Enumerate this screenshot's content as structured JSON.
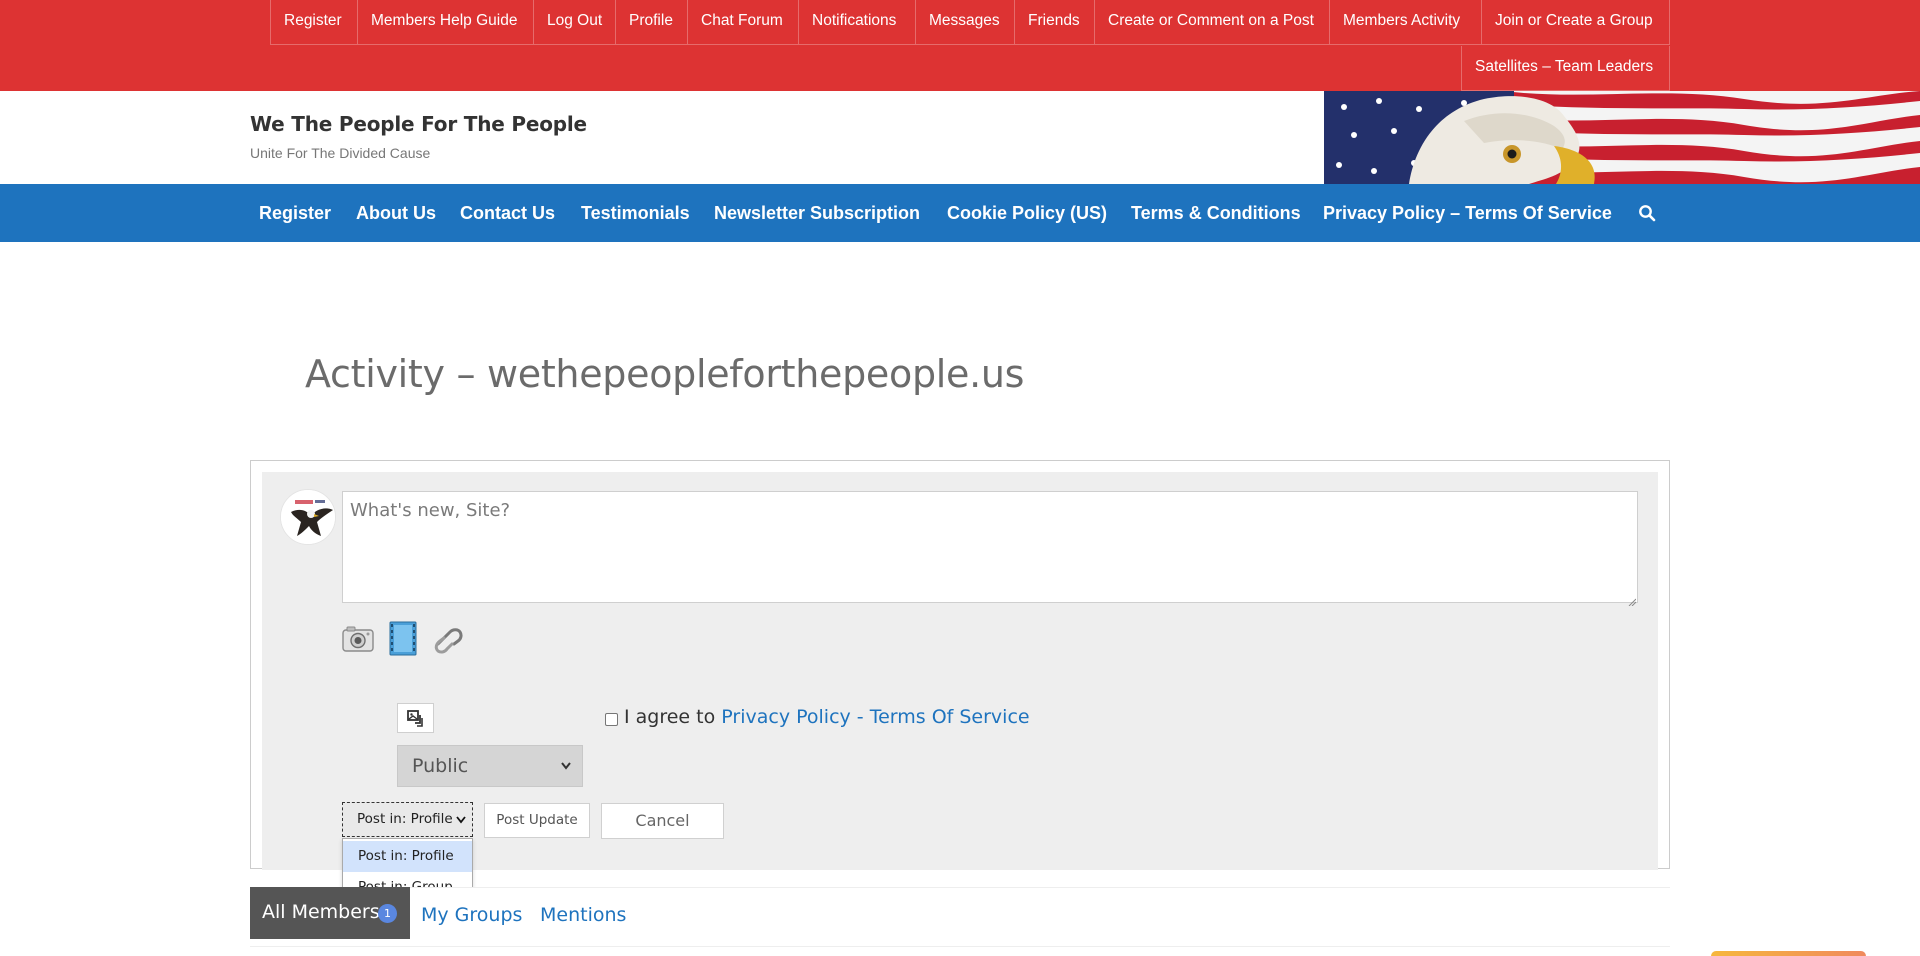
{
  "top_menu": {
    "items": [
      "Register",
      "Members Help Guide",
      "Log Out",
      "Profile",
      "Chat Forum",
      "Notifications",
      "Messages",
      "Friends",
      "Create or Comment on a Post",
      "Members Activity",
      "Join or Create a Group"
    ],
    "second_row": [
      "Satellites – Team Leaders"
    ]
  },
  "site": {
    "title": "We The People For The People",
    "tagline": "Unite For The Divided Cause"
  },
  "main_nav": {
    "items": [
      "Register",
      "About Us",
      "Contact Us",
      "Testimonials",
      "Newsletter Subscription",
      "Cookie Policy (US)",
      "Terms & Conditions",
      "Privacy Policy – Terms Of Service"
    ],
    "search_icon": "search-icon"
  },
  "page": {
    "title": "Activity – wethepeopleforthepeople.us"
  },
  "post_form": {
    "placeholder": "What's new, Site?",
    "media_icons": [
      "camera-icon",
      "video-icon",
      "link-icon"
    ],
    "image_button_icon": "image-switch-icon",
    "visibility": "Public",
    "agree_prefix": "I agree to ",
    "agree_link": "Privacy Policy - Terms Of Service",
    "post_in_selected": "Post in: Profile",
    "post_in_options": [
      "Post in: Profile",
      "Post in: Group"
    ],
    "post_update_label": "Post Update",
    "cancel_label": "Cancel"
  },
  "tabs": {
    "all_members": "All Members",
    "all_members_count": "1",
    "my_groups": "My Groups",
    "mentions": "Mentions"
  },
  "colors": {
    "top_bar": "#dd3333",
    "main_nav": "#1e73be",
    "link": "#1e73be"
  }
}
